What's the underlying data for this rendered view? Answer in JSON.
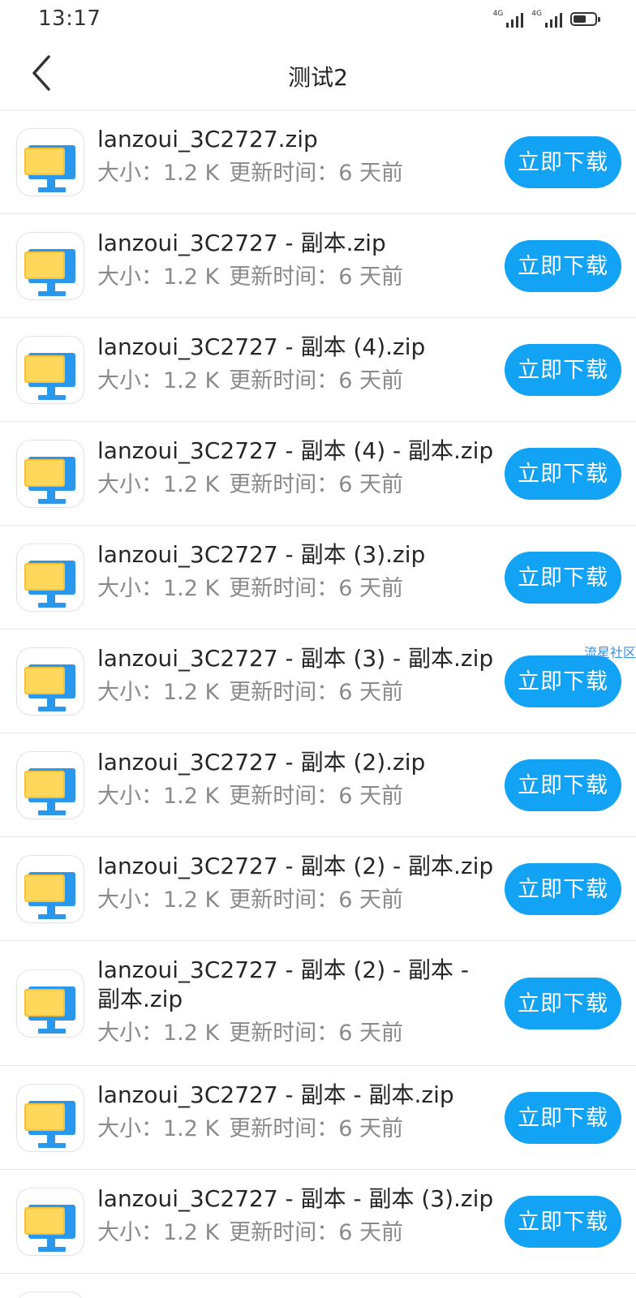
{
  "status_bar": {
    "time": "13:17",
    "signal_1": "4G",
    "signal_2": "4G",
    "battery_percent": 60
  },
  "nav": {
    "back_icon": "chevron-left-icon",
    "title": "测试2"
  },
  "file_icon": "computer-monitor-icon",
  "files": [
    {
      "name": "lanzoui_3C2727.zip",
      "size_label": "大小：1.2 K",
      "time_label": "更新时间：6 天前",
      "button": "立即下载"
    },
    {
      "name": "lanzoui_3C2727 - 副本.zip",
      "size_label": "大小：1.2 K",
      "time_label": "更新时间：6 天前",
      "button": "立即下载"
    },
    {
      "name": "lanzoui_3C2727 - 副本 (4).zip",
      "size_label": "大小：1.2 K",
      "time_label": "更新时间：6 天前",
      "button": "立即下载"
    },
    {
      "name": "lanzoui_3C2727 - 副本 (4) - 副本.zip",
      "size_label": "大小：1.2 K",
      "time_label": "更新时间：6 天前",
      "button": "立即下载"
    },
    {
      "name": "lanzoui_3C2727 - 副本 (3).zip",
      "size_label": "大小：1.2 K",
      "time_label": "更新时间：6 天前",
      "button": "立即下载"
    },
    {
      "name": "lanzoui_3C2727 - 副本 (3) - 副本.zip",
      "size_label": "大小：1.2 K",
      "time_label": "更新时间：6 天前",
      "button": "立即下载"
    },
    {
      "name": "lanzoui_3C2727 - 副本 (2).zip",
      "size_label": "大小：1.2 K",
      "time_label": "更新时间：6 天前",
      "button": "立即下载"
    },
    {
      "name": "lanzoui_3C2727 - 副本 (2) - 副本.zip",
      "size_label": "大小：1.2 K",
      "time_label": "更新时间：6 天前",
      "button": "立即下载"
    },
    {
      "name": "lanzoui_3C2727 - 副本 (2) - 副本 - 副本.zip",
      "size_label": "大小：1.2 K",
      "time_label": "更新时间：6 天前",
      "button": "立即下载"
    },
    {
      "name": "lanzoui_3C2727 - 副本 - 副本.zip",
      "size_label": "大小：1.2 K",
      "time_label": "更新时间：6 天前",
      "button": "立即下载"
    },
    {
      "name": "lanzoui_3C2727 - 副本 - 副本 (3).zip",
      "size_label": "大小：1.2 K",
      "time_label": "更新时间：6 天前",
      "button": "立即下载"
    }
  ],
  "watermark": "流星社区",
  "colors": {
    "accent": "#12a3f5",
    "icon_blue": "#2a97ea",
    "icon_yellow": "#ffd75a"
  }
}
